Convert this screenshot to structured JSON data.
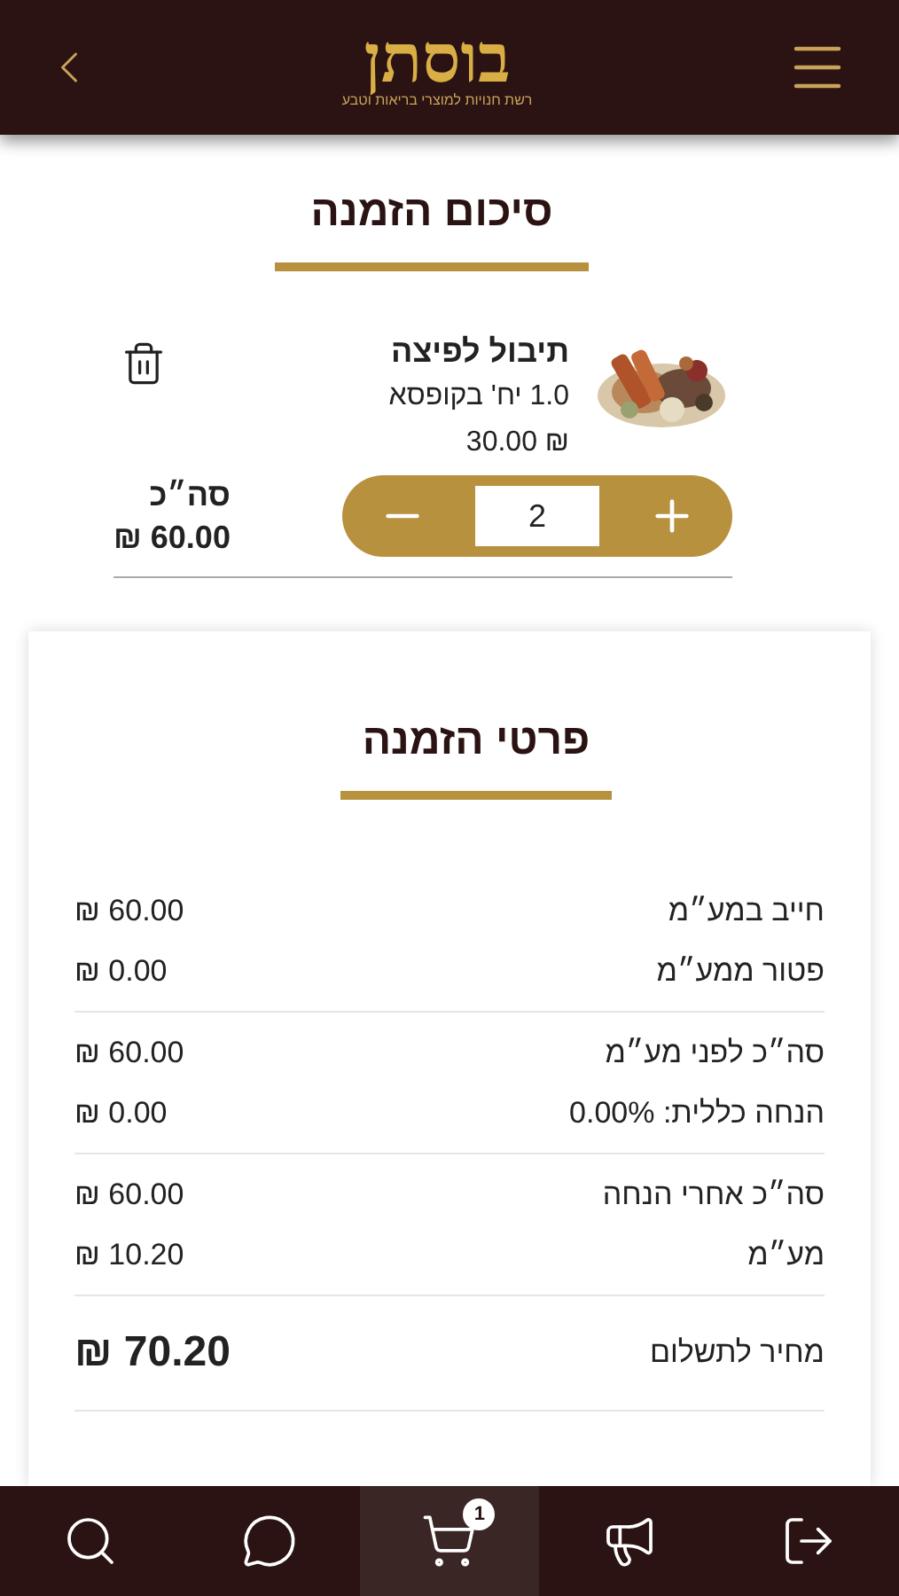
{
  "header": {
    "logo": "בוסתן",
    "tagline": "רשת חנויות למוצרי בריאות וטבע"
  },
  "summary_title": "סיכום הזמנה",
  "items": [
    {
      "kind": "picture",
      "name": "תיבול לפיצה",
      "unit": "1.0 יח' בקופסא",
      "price": "₪ 30.00",
      "quantity": "2",
      "total_label": "סה״כ",
      "total": "₪ 60.00"
    }
  ],
  "details": {
    "title": "פרטי הזמנה",
    "groups": [
      [
        {
          "label": "חייב במע״מ",
          "value": "₪ 60.00"
        },
        {
          "label": "פטור ממע״מ",
          "value": "₪ 0.00"
        }
      ],
      [
        {
          "label": "סה״כ לפני מע״מ",
          "value": "₪ 60.00"
        },
        {
          "label": "הנחה כללית: 0.00%",
          "value": "₪ 0.00"
        }
      ],
      [
        {
          "label": "סה״כ אחרי הנחה",
          "value": "₪ 60.00"
        },
        {
          "label": "מע״מ",
          "value": "₪ 10.20"
        }
      ],
      [
        {
          "label": "מחיר לתשלום",
          "value": "₪ 70.20",
          "kind": "total"
        }
      ]
    ]
  },
  "nav": [
    {
      "kind": "logout",
      "selected": false
    },
    {
      "kind": "megaphone",
      "selected": false
    },
    {
      "kind": "cart",
      "selected": true,
      "badge": "1"
    },
    {
      "kind": "chat",
      "selected": false
    },
    {
      "kind": "search",
      "selected": false
    }
  ]
}
